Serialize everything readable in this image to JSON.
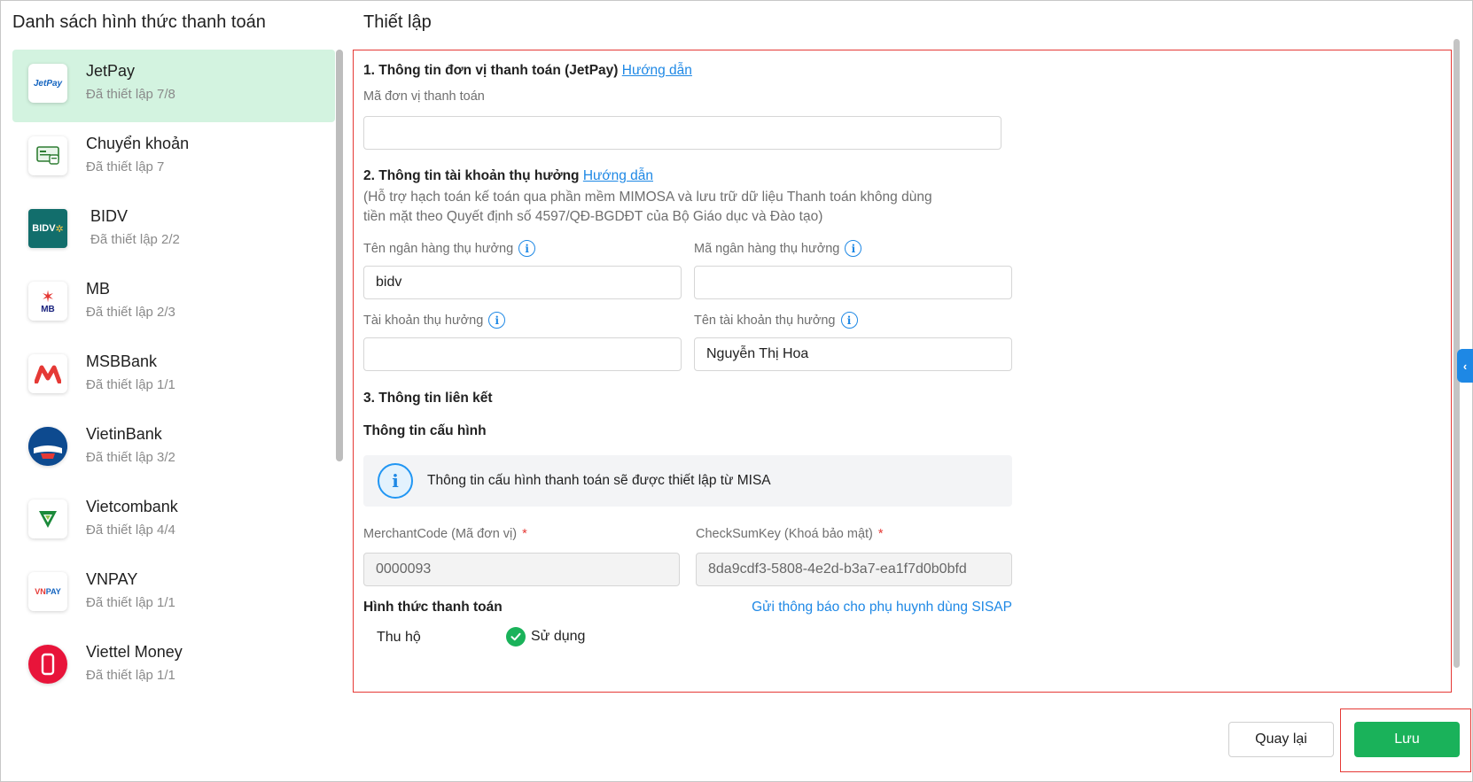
{
  "left_title": "Danh sách hình thức thanh toán",
  "right_title": "Thiết lập",
  "payment_methods": [
    {
      "name": "JetPay",
      "status": "Đã thiết lập 7/8",
      "logo_text": "JetPay",
      "active": true
    },
    {
      "name": "Chuyển khoản",
      "status": "Đã thiết lập 7",
      "logo_text": ""
    },
    {
      "name": "BIDV",
      "status": "Đã thiết lập 2/2",
      "logo_text": "BIDV"
    },
    {
      "name": "MB",
      "status": "Đã thiết lập 2/3",
      "logo_text": "MB"
    },
    {
      "name": "MSBBank",
      "status": "Đã thiết lập 1/1",
      "logo_text": ""
    },
    {
      "name": "VietinBank",
      "status": "Đã thiết lập 3/2",
      "logo_text": ""
    },
    {
      "name": "Vietcombank",
      "status": "Đã thiết lập 4/4",
      "logo_text": ""
    },
    {
      "name": "VNPAY",
      "status": "Đã thiết lập 1/1",
      "logo_text": "VNPAY"
    },
    {
      "name": "Viettel Money",
      "status": "Đã thiết lập 1/1",
      "logo_text": ""
    }
  ],
  "section1": {
    "title": "1. Thông tin đơn vị thanh toán (JetPay)",
    "guide_link": "Hướng dẫn",
    "merchant_unit_label": "Mã đơn vị thanh toán",
    "merchant_unit_value": ""
  },
  "section2": {
    "title": "2. Thông tin tài khoản thụ hưởng",
    "guide_link": "Hướng dẫn",
    "note_line1": "(Hỗ trợ hạch toán kế toán qua phần mềm MIMOSA và lưu trữ dữ liệu Thanh toán không dùng",
    "note_line2": "tiền mặt theo Quyết định số 4597/QĐ-BGDĐT của Bộ Giáo dục và Đào tạo)",
    "bank_name_label": "Tên ngân hàng thụ hưởng",
    "bank_name_value": "bidv",
    "bank_code_label": "Mã ngân hàng thụ hưởng",
    "bank_code_value": "",
    "account_label": "Tài khoản thụ hưởng",
    "account_value": "",
    "account_name_label": "Tên tài khoản thụ hưởng",
    "account_name_value": "Nguyễn Thị Hoa"
  },
  "section3": {
    "title": "3. Thông tin liên kết",
    "config_title": "Thông tin cấu hình",
    "info_message": "Thông tin cấu hình thanh toán sẽ được thiết lập từ MISA",
    "merchant_code_label": "MerchantCode (Mã đơn vị)",
    "merchant_code_value": "0000093",
    "checksum_label": "CheckSumKey (Khoá bảo mật)",
    "checksum_value": "8da9cdf3-5808-4e2d-b3a7-ea1f7d0b0bfd",
    "required_mark": "*",
    "payment_form_title": "Hình thức thanh toán",
    "notify_link": "Gửi thông báo cho phụ huynh dùng SISAP",
    "collect_label": "Thu hộ",
    "use_label": "Sử dụng"
  },
  "footer": {
    "back_label": "Quay lại",
    "save_label": "Lưu"
  },
  "colors": {
    "accent_green": "#1ab25a",
    "active_bg": "#d3f3e0",
    "link_blue": "#1e88e5",
    "highlight_red": "#e53935"
  }
}
